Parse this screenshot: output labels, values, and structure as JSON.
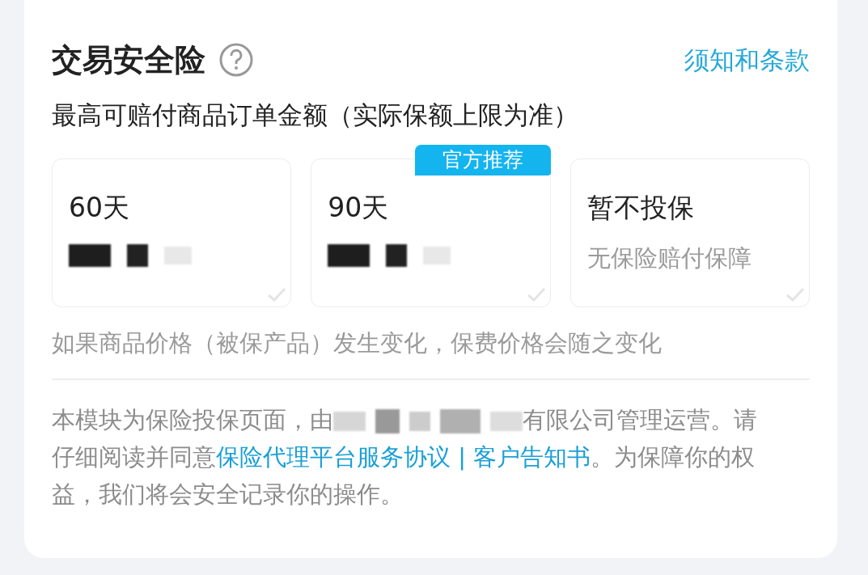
{
  "header": {
    "title": "交易安全险",
    "terms_link": "须知和条款"
  },
  "subtitle": "最高可赔付商品订单金额（实际保额上限为准）",
  "options": [
    {
      "kind": "priced",
      "title": "60天",
      "selected": false
    },
    {
      "kind": "priced",
      "title": "90天",
      "badge": "官方推荐",
      "selected": false
    },
    {
      "kind": "plain",
      "title": "暂不投保",
      "subtitle": "无保险赔付保障",
      "selected": false
    }
  ],
  "price_note": "如果商品价格（被保产品）发生变化，保费价格会随之变化",
  "footer": [
    {
      "kind": "text",
      "text": "本模块为保险投保页面，由"
    },
    {
      "kind": "redacted"
    },
    {
      "kind": "text",
      "text": "有限公司管理运营。请仔细阅读并同意"
    },
    {
      "kind": "link",
      "text": "保险代理平台服务协议 | 客户告知书"
    },
    {
      "kind": "text",
      "text": "。为保障你的权益，我们将会安全记录你的操作。"
    }
  ]
}
